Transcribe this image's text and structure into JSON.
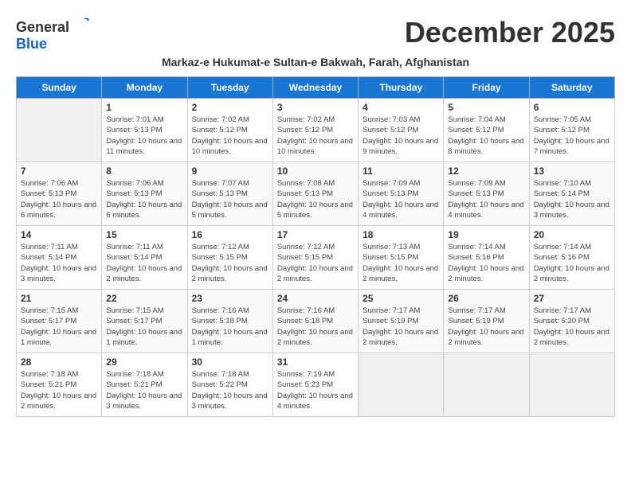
{
  "logo": {
    "text_general": "General",
    "text_blue": "Blue"
  },
  "title": "December 2025",
  "subtitle": "Markaz-e Hukumat-e Sultan-e Bakwah, Farah, Afghanistan",
  "days_of_week": [
    "Sunday",
    "Monday",
    "Tuesday",
    "Wednesday",
    "Thursday",
    "Friday",
    "Saturday"
  ],
  "weeks": [
    [
      {
        "num": "",
        "sunrise": "",
        "sunset": "",
        "daylight": "",
        "empty": true
      },
      {
        "num": "1",
        "sunrise": "Sunrise: 7:01 AM",
        "sunset": "Sunset: 5:13 PM",
        "daylight": "Daylight: 10 hours and 11 minutes."
      },
      {
        "num": "2",
        "sunrise": "Sunrise: 7:02 AM",
        "sunset": "Sunset: 5:12 PM",
        "daylight": "Daylight: 10 hours and 10 minutes."
      },
      {
        "num": "3",
        "sunrise": "Sunrise: 7:02 AM",
        "sunset": "Sunset: 5:12 PM",
        "daylight": "Daylight: 10 hours and 10 minutes."
      },
      {
        "num": "4",
        "sunrise": "Sunrise: 7:03 AM",
        "sunset": "Sunset: 5:12 PM",
        "daylight": "Daylight: 10 hours and 9 minutes."
      },
      {
        "num": "5",
        "sunrise": "Sunrise: 7:04 AM",
        "sunset": "Sunset: 5:12 PM",
        "daylight": "Daylight: 10 hours and 8 minutes."
      },
      {
        "num": "6",
        "sunrise": "Sunrise: 7:05 AM",
        "sunset": "Sunset: 5:12 PM",
        "daylight": "Daylight: 10 hours and 7 minutes."
      }
    ],
    [
      {
        "num": "7",
        "sunrise": "Sunrise: 7:06 AM",
        "sunset": "Sunset: 5:13 PM",
        "daylight": "Daylight: 10 hours and 6 minutes."
      },
      {
        "num": "8",
        "sunrise": "Sunrise: 7:06 AM",
        "sunset": "Sunset: 5:13 PM",
        "daylight": "Daylight: 10 hours and 6 minutes."
      },
      {
        "num": "9",
        "sunrise": "Sunrise: 7:07 AM",
        "sunset": "Sunset: 5:13 PM",
        "daylight": "Daylight: 10 hours and 5 minutes."
      },
      {
        "num": "10",
        "sunrise": "Sunrise: 7:08 AM",
        "sunset": "Sunset: 5:13 PM",
        "daylight": "Daylight: 10 hours and 5 minutes."
      },
      {
        "num": "11",
        "sunrise": "Sunrise: 7:09 AM",
        "sunset": "Sunset: 5:13 PM",
        "daylight": "Daylight: 10 hours and 4 minutes."
      },
      {
        "num": "12",
        "sunrise": "Sunrise: 7:09 AM",
        "sunset": "Sunset: 5:13 PM",
        "daylight": "Daylight: 10 hours and 4 minutes."
      },
      {
        "num": "13",
        "sunrise": "Sunrise: 7:10 AM",
        "sunset": "Sunset: 5:14 PM",
        "daylight": "Daylight: 10 hours and 3 minutes."
      }
    ],
    [
      {
        "num": "14",
        "sunrise": "Sunrise: 7:11 AM",
        "sunset": "Sunset: 5:14 PM",
        "daylight": "Daylight: 10 hours and 3 minutes."
      },
      {
        "num": "15",
        "sunrise": "Sunrise: 7:11 AM",
        "sunset": "Sunset: 5:14 PM",
        "daylight": "Daylight: 10 hours and 2 minutes."
      },
      {
        "num": "16",
        "sunrise": "Sunrise: 7:12 AM",
        "sunset": "Sunset: 5:15 PM",
        "daylight": "Daylight: 10 hours and 2 minutes."
      },
      {
        "num": "17",
        "sunrise": "Sunrise: 7:12 AM",
        "sunset": "Sunset: 5:15 PM",
        "daylight": "Daylight: 10 hours and 2 minutes."
      },
      {
        "num": "18",
        "sunrise": "Sunrise: 7:13 AM",
        "sunset": "Sunset: 5:15 PM",
        "daylight": "Daylight: 10 hours and 2 minutes."
      },
      {
        "num": "19",
        "sunrise": "Sunrise: 7:14 AM",
        "sunset": "Sunset: 5:16 PM",
        "daylight": "Daylight: 10 hours and 2 minutes."
      },
      {
        "num": "20",
        "sunrise": "Sunrise: 7:14 AM",
        "sunset": "Sunset: 5:16 PM",
        "daylight": "Daylight: 10 hours and 2 minutes."
      }
    ],
    [
      {
        "num": "21",
        "sunrise": "Sunrise: 7:15 AM",
        "sunset": "Sunset: 5:17 PM",
        "daylight": "Daylight: 10 hours and 1 minute."
      },
      {
        "num": "22",
        "sunrise": "Sunrise: 7:15 AM",
        "sunset": "Sunset: 5:17 PM",
        "daylight": "Daylight: 10 hours and 1 minute."
      },
      {
        "num": "23",
        "sunrise": "Sunrise: 7:16 AM",
        "sunset": "Sunset: 5:18 PM",
        "daylight": "Daylight: 10 hours and 1 minute."
      },
      {
        "num": "24",
        "sunrise": "Sunrise: 7:16 AM",
        "sunset": "Sunset: 5:18 PM",
        "daylight": "Daylight: 10 hours and 2 minutes."
      },
      {
        "num": "25",
        "sunrise": "Sunrise: 7:17 AM",
        "sunset": "Sunset: 5:19 PM",
        "daylight": "Daylight: 10 hours and 2 minutes."
      },
      {
        "num": "26",
        "sunrise": "Sunrise: 7:17 AM",
        "sunset": "Sunset: 5:19 PM",
        "daylight": "Daylight: 10 hours and 2 minutes."
      },
      {
        "num": "27",
        "sunrise": "Sunrise: 7:17 AM",
        "sunset": "Sunset: 5:20 PM",
        "daylight": "Daylight: 10 hours and 2 minutes."
      }
    ],
    [
      {
        "num": "28",
        "sunrise": "Sunrise: 7:18 AM",
        "sunset": "Sunset: 5:21 PM",
        "daylight": "Daylight: 10 hours and 2 minutes."
      },
      {
        "num": "29",
        "sunrise": "Sunrise: 7:18 AM",
        "sunset": "Sunset: 5:21 PM",
        "daylight": "Daylight: 10 hours and 3 minutes."
      },
      {
        "num": "30",
        "sunrise": "Sunrise: 7:18 AM",
        "sunset": "Sunset: 5:22 PM",
        "daylight": "Daylight: 10 hours and 3 minutes."
      },
      {
        "num": "31",
        "sunrise": "Sunrise: 7:19 AM",
        "sunset": "Sunset: 5:23 PM",
        "daylight": "Daylight: 10 hours and 4 minutes."
      },
      {
        "num": "",
        "sunrise": "",
        "sunset": "",
        "daylight": "",
        "empty": true
      },
      {
        "num": "",
        "sunrise": "",
        "sunset": "",
        "daylight": "",
        "empty": true
      },
      {
        "num": "",
        "sunrise": "",
        "sunset": "",
        "daylight": "",
        "empty": true
      }
    ]
  ]
}
